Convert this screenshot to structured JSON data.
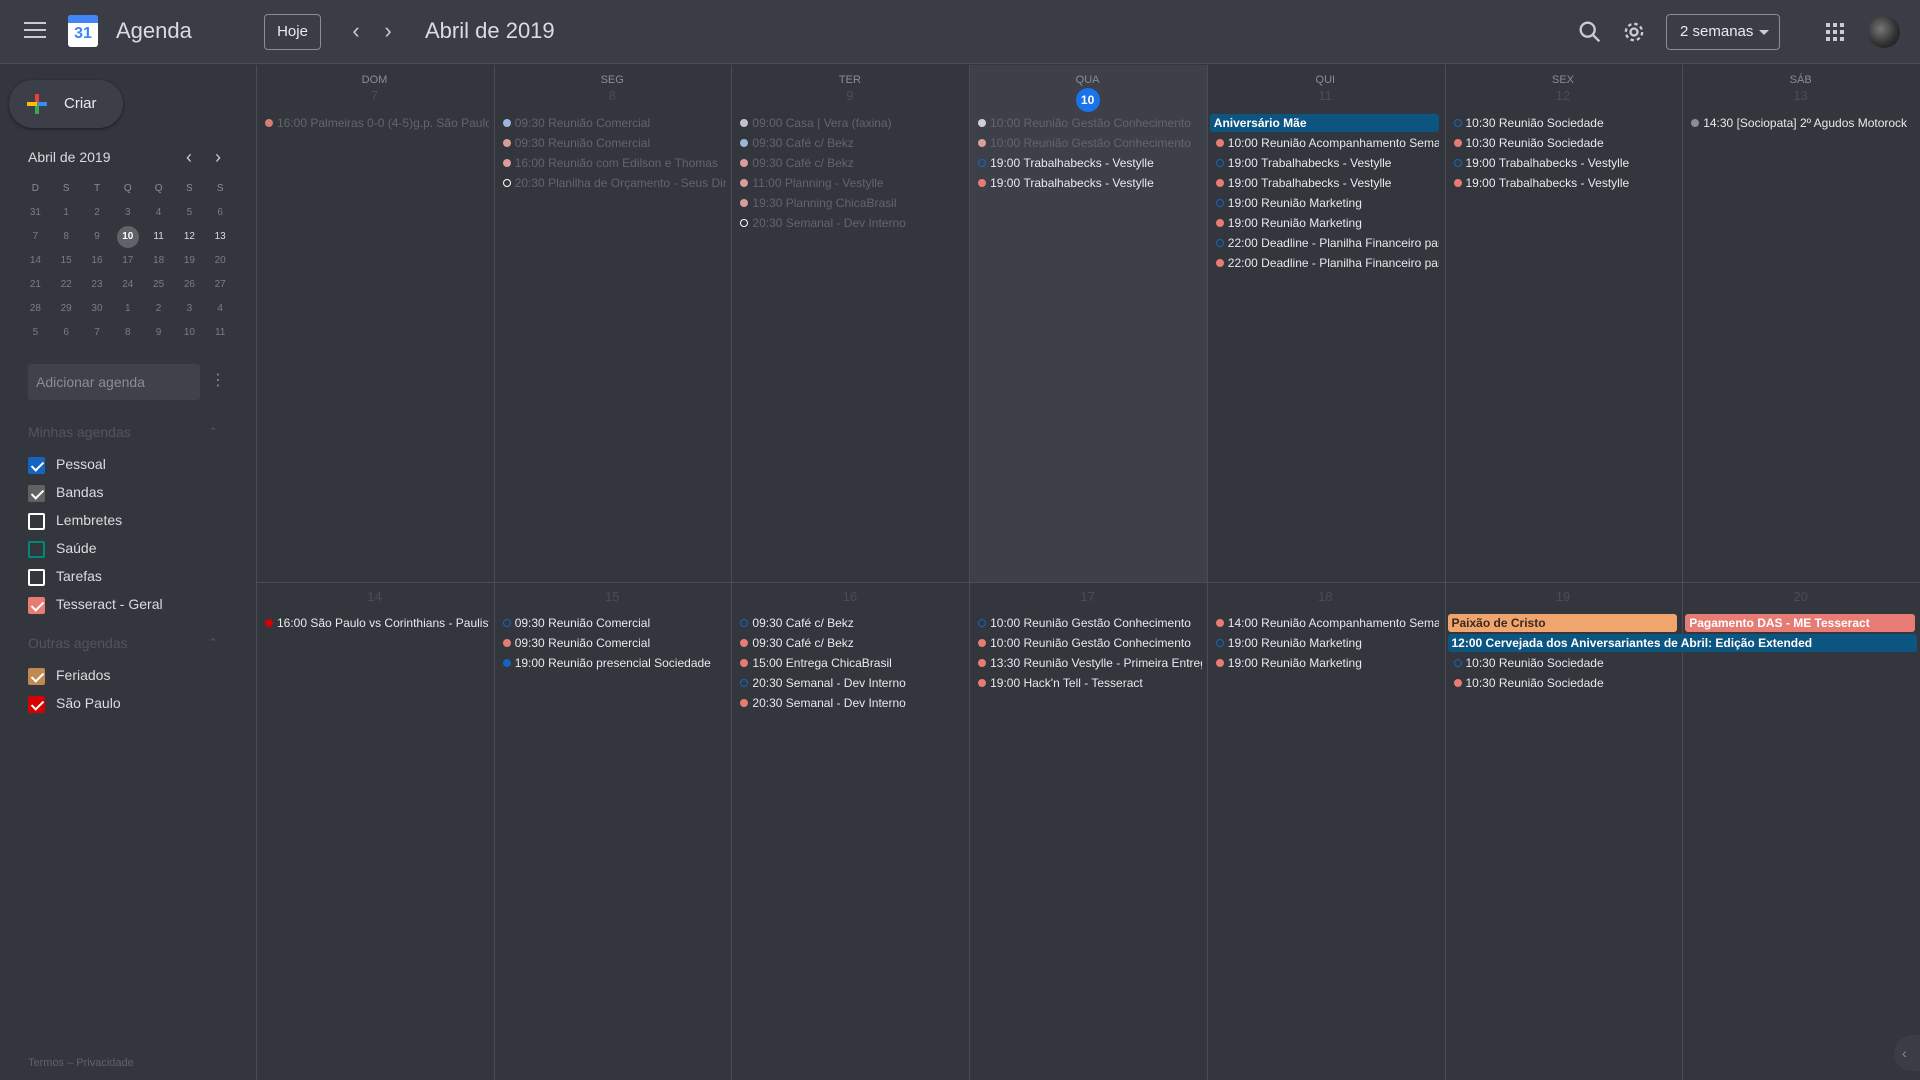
{
  "header": {
    "app_logo_number": "31",
    "app_title": "Agenda",
    "today_label": "Hoje",
    "month_label": "Abril de 2019",
    "view_label": "2 semanas"
  },
  "sidebar": {
    "create_label": "Criar",
    "mini_month": "Abril de 2019",
    "weekday_initials": [
      "D",
      "S",
      "T",
      "Q",
      "Q",
      "S",
      "S"
    ],
    "mini_weeks": [
      [
        "31",
        "1",
        "2",
        "3",
        "4",
        "5",
        "6"
      ],
      [
        "7",
        "8",
        "9",
        "10",
        "11",
        "12",
        "13"
      ],
      [
        "14",
        "15",
        "16",
        "17",
        "18",
        "19",
        "20"
      ],
      [
        "21",
        "22",
        "23",
        "24",
        "25",
        "26",
        "27"
      ],
      [
        "28",
        "29",
        "30",
        "1",
        "2",
        "3",
        "4"
      ],
      [
        "5",
        "6",
        "7",
        "8",
        "9",
        "10",
        "11"
      ]
    ],
    "add_calendar_placeholder": "Adicionar agenda",
    "my_calendars_heading": "Minhas agendas",
    "other_calendars_heading": "Outras agendas",
    "my_calendars": [
      {
        "name": "Pessoal",
        "color": "#1565c0",
        "checked": true
      },
      {
        "name": "Bandas",
        "color": "#616161",
        "checked": true
      },
      {
        "name": "Lembretes",
        "color": "#ffffff",
        "checked": false
      },
      {
        "name": "Saúde",
        "color": "#00897b",
        "checked": false
      },
      {
        "name": "Tarefas",
        "color": "#ffffff",
        "checked": false
      },
      {
        "name": "Tesseract - Geral",
        "color": "#e67c73",
        "checked": true
      }
    ],
    "other_calendars": [
      {
        "name": "Feriados",
        "color": "#c0894f",
        "checked": true
      },
      {
        "name": "São Paulo",
        "color": "#d50000",
        "checked": true
      }
    ],
    "footer": "Termos – Privacidade"
  },
  "calendar": {
    "weekday_headers": [
      "DOM",
      "SEG",
      "TER",
      "QUA",
      "QUI",
      "SEX",
      "SÁB"
    ],
    "weeks": [
      {
        "dates": [
          "7",
          "8",
          "9",
          "10",
          "11",
          "12",
          "13"
        ],
        "days": [
          [
            {
              "time": "16:00",
              "title": "Palmeiras 0-0 (4-5)g.p. São Paulo",
              "color": "#f28b82",
              "past": true
            }
          ],
          [
            {
              "time": "09:30",
              "title": "Reunião Comercial",
              "color": "#aecbfa",
              "past": true
            },
            {
              "time": "09:30",
              "title": "Reunião Comercial",
              "color": "#f6aea9",
              "past": true
            },
            {
              "time": "16:00",
              "title": "Reunião com Edilson e Thomas",
              "color": "#f6aea9",
              "past": true
            },
            {
              "time": "20:30",
              "title": "Planilha de Orçamento - Seus Direitos",
              "color": "#ffffff",
              "ring": true,
              "past": true
            }
          ],
          [
            {
              "time": "09:00",
              "title": "Casa | Vera (faxina)",
              "color": "#d7dce1",
              "past": true
            },
            {
              "time": "09:30",
              "title": "Café c/ Bekz",
              "color": "#aecbfa",
              "past": true
            },
            {
              "time": "09:30",
              "title": "Café c/ Bekz",
              "color": "#f6aea9",
              "past": true
            },
            {
              "time": "11:00",
              "title": "Planning - Vestylle",
              "color": "#f6aea9",
              "past": true
            },
            {
              "time": "19:30",
              "title": "Planning ChicaBrasil",
              "color": "#f6aea9",
              "past": true
            },
            {
              "time": "20:30",
              "title": "Semanal - Dev Interno",
              "color": "#ffffff",
              "ring": true,
              "past": true
            }
          ],
          [
            {
              "time": "10:00",
              "title": "Reunião Gestão Conhecimento",
              "color": "#e8eaed",
              "past": true
            },
            {
              "time": "10:00",
              "title": "Reunião Gestão Conhecimento",
              "color": "#f6aea9",
              "past": true
            },
            {
              "time": "19:00",
              "title": "Trabalhabecks - Vestylle",
              "color": "#1565c0",
              "ring": true
            },
            {
              "time": "19:00",
              "title": "Trabalhabecks - Vestylle",
              "color": "#e67c73"
            }
          ],
          [
            {
              "bar": true,
              "title": "Aniversário Mãe",
              "color": "#0b5580"
            },
            {
              "time": "10:00",
              "title": "Reunião Acompanhamento Semanal",
              "color": "#e67c73"
            },
            {
              "time": "19:00",
              "title": "Trabalhabecks - Vestylle",
              "color": "#1565c0",
              "ring": true
            },
            {
              "time": "19:00",
              "title": "Trabalhabecks - Vestylle",
              "color": "#e67c73"
            },
            {
              "time": "19:00",
              "title": "Reunião Marketing",
              "color": "#1565c0",
              "ring": true
            },
            {
              "time": "19:00",
              "title": "Reunião Marketing",
              "color": "#e67c73"
            },
            {
              "time": "22:00",
              "title": "Deadline - Planilha Financeiro para",
              "color": "#1565c0",
              "ring": true
            },
            {
              "time": "22:00",
              "title": "Deadline - Planilha Financeiro para",
              "color": "#e67c73"
            }
          ],
          [
            {
              "time": "10:30",
              "title": "Reunião Sociedade",
              "color": "#1565c0",
              "ring": true
            },
            {
              "time": "10:30",
              "title": "Reunião Sociedade",
              "color": "#e67c73"
            },
            {
              "time": "19:00",
              "title": "Trabalhabecks - Vestylle",
              "color": "#1565c0",
              "ring": true
            },
            {
              "time": "19:00",
              "title": "Trabalhabecks - Vestylle",
              "color": "#e67c73"
            }
          ],
          [
            {
              "time": "14:30",
              "title": "[Sociopata] 2º Agudos Motorock",
              "color": "#8a8d93"
            }
          ]
        ]
      },
      {
        "dates": [
          "14",
          "15",
          "16",
          "17",
          "18",
          "19",
          "20"
        ],
        "days": [
          [
            {
              "time": "16:00",
              "title": "São Paulo vs Corinthians - Paulista",
              "color": "#d50000"
            }
          ],
          [
            {
              "time": "09:30",
              "title": "Reunião Comercial",
              "color": "#1565c0",
              "ring": true
            },
            {
              "time": "09:30",
              "title": "Reunião Comercial",
              "color": "#e67c73"
            },
            {
              "time": "19:00",
              "title": "Reunião presencial Sociedade",
              "color": "#1565c0"
            }
          ],
          [
            {
              "time": "09:30",
              "title": "Café c/ Bekz",
              "color": "#1565c0",
              "ring": true
            },
            {
              "time": "09:30",
              "title": "Café c/ Bekz",
              "color": "#e67c73"
            },
            {
              "time": "15:00",
              "title": "Entrega ChicaBrasil",
              "color": "#e67c73"
            },
            {
              "time": "20:30",
              "title": "Semanal - Dev Interno",
              "color": "#1565c0",
              "ring": true
            },
            {
              "time": "20:30",
              "title": "Semanal - Dev Interno",
              "color": "#e67c73"
            }
          ],
          [
            {
              "time": "10:00",
              "title": "Reunião Gestão Conhecimento",
              "color": "#1565c0",
              "ring": true
            },
            {
              "time": "10:00",
              "title": "Reunião Gestão Conhecimento",
              "color": "#e67c73"
            },
            {
              "time": "13:30",
              "title": "Reunião Vestylle - Primeira Entrega",
              "color": "#e67c73"
            },
            {
              "time": "19:00",
              "title": "Hack'n Tell - Tesseract",
              "color": "#e67c73"
            }
          ],
          [
            {
              "time": "14:00",
              "title": "Reunião Acompanhamento Semanal",
              "color": "#e67c73"
            },
            {
              "time": "19:00",
              "title": "Reunião Marketing",
              "color": "#1565c0",
              "ring": true
            },
            {
              "time": "19:00",
              "title": "Reunião Marketing",
              "color": "#e67c73"
            }
          ],
          [
            {
              "bar": true,
              "title": "Paixão de Cristo",
              "color": "#f0a46e",
              "dark": true
            },
            {
              "spacer": true
            },
            {
              "time": "10:30",
              "title": "Reunião Sociedade",
              "color": "#1565c0",
              "ring": true
            },
            {
              "time": "10:30",
              "title": "Reunião Sociedade",
              "color": "#e67c73"
            }
          ],
          [
            {
              "bar": true,
              "title": "Pagamento DAS - ME Tesseract",
              "color": "#e67c73"
            }
          ]
        ],
        "span_event": {
          "time": "12:00",
          "title": "Cervejada dos Aniversariantes de Abril: Edição Extended",
          "color": "#0b5580"
        }
      }
    ]
  }
}
